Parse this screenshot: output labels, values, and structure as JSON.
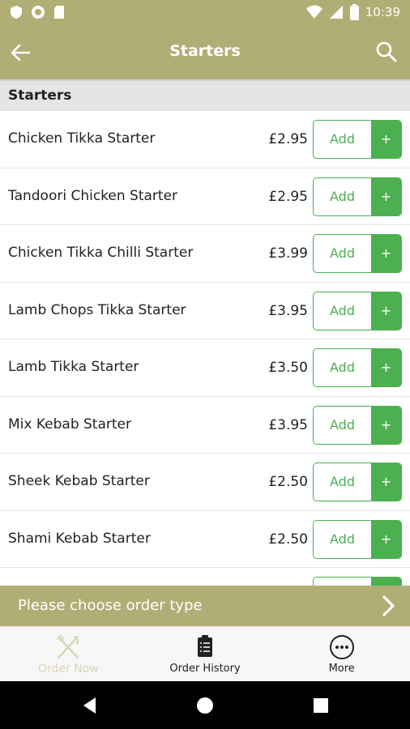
{
  "status_bar": {
    "time": "10:39"
  },
  "app_bar": {
    "title": "Starters"
  },
  "section": {
    "title": "Starters"
  },
  "items": [
    {
      "name": "Chicken Tikka Starter",
      "price": "£2.95"
    },
    {
      "name": "Tandoori Chicken Starter",
      "price": "£2.95"
    },
    {
      "name": "Chicken Tikka Chilli Starter",
      "price": "£3.99"
    },
    {
      "name": "Lamb Chops Tikka Starter",
      "price": "£3.95"
    },
    {
      "name": "Lamb Tikka Starter",
      "price": "£3.50"
    },
    {
      "name": "Mix Kebab Starter",
      "price": "£3.95"
    },
    {
      "name": "Sheek Kebab Starter",
      "price": "£2.50"
    },
    {
      "name": "Shami Kebab Starter",
      "price": "£2.50"
    },
    {
      "name": "",
      "price": ""
    }
  ],
  "add_button": {
    "label": "Add",
    "plus": "+"
  },
  "order_type_bar": {
    "text": "Please choose order type"
  },
  "bottom_nav": {
    "order_now": "Order Now",
    "order_history": "Order History",
    "more": "More"
  },
  "colors": {
    "brand": "#b1ae75",
    "accent_green": "#4caf50"
  }
}
